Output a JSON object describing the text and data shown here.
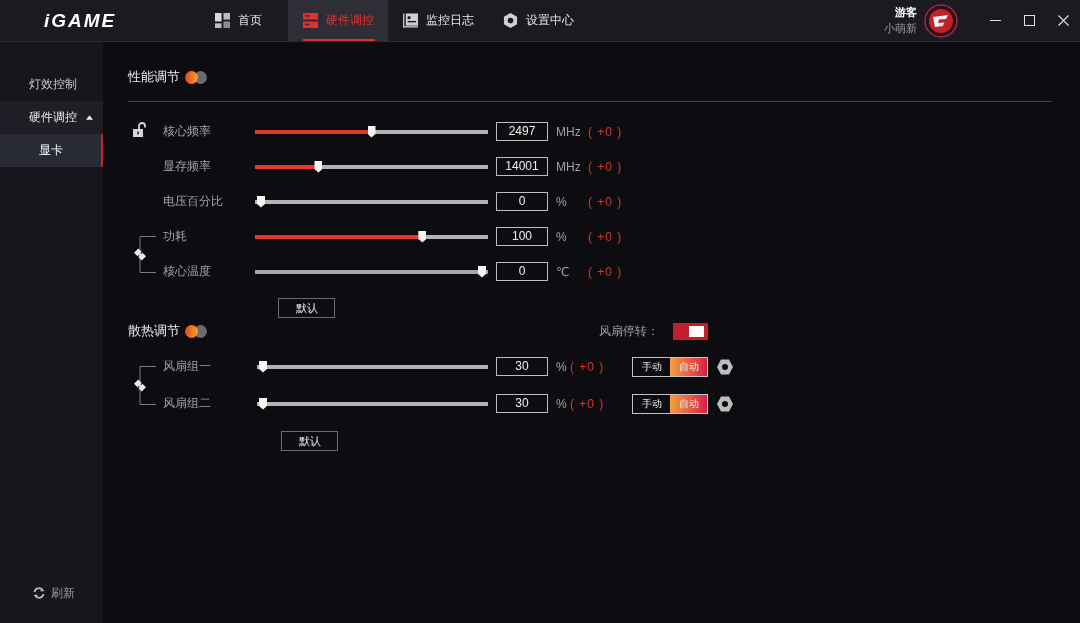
{
  "window": {
    "logo": "iGAME"
  },
  "nav_tabs": [
    {
      "label": "首页",
      "selected": false
    },
    {
      "label": "硬件调控",
      "selected": true
    },
    {
      "label": "监控日志",
      "selected": false
    },
    {
      "label": "设置中心",
      "selected": false
    }
  ],
  "user": {
    "name": "游客",
    "rank": "小萌新"
  },
  "sidebar": {
    "items": [
      {
        "label": "灯效控制",
        "selected": false
      },
      {
        "label": "硬件调控",
        "selected": false,
        "expanded": true,
        "children": [
          {
            "label": "显卡",
            "selected": true
          }
        ]
      }
    ],
    "refresh": "刷新"
  },
  "performance": {
    "title": "性能调节",
    "on": false,
    "rows": [
      {
        "label": "核心频率",
        "level": 0.5,
        "value": "2497",
        "unit": "MHz",
        "delta": "( +0 )",
        "disabled": false
      },
      {
        "label": "显存频率",
        "level": 0.26,
        "value": "14001",
        "unit": "MHz",
        "delta": "( +0 )",
        "disabled": false
      },
      {
        "label": "电压百分比",
        "level": 0,
        "value": "0",
        "unit": "%",
        "delta": "( +0 )",
        "disabled": false
      },
      {
        "label": "功耗",
        "level": 0.73,
        "value": "100",
        "unit": "%",
        "delta": "( +0 )",
        "disabled": false
      },
      {
        "label": "核心温度",
        "level": 1,
        "value": "0",
        "unit": "℃",
        "delta": "( +0 )",
        "disabled": true
      }
    ],
    "default_button": "默认"
  },
  "cooling": {
    "title": "散热调节",
    "on": false,
    "fan_stop": {
      "label": "风扇停转：",
      "on": true
    },
    "rows": [
      {
        "label": "风扇组一",
        "level": 0,
        "value": "30",
        "unit": "%",
        "delta": "( +0 )",
        "modes": [
          {
            "label": "手动",
            "selected": false
          },
          {
            "label": "自动",
            "selected": true
          }
        ]
      },
      {
        "label": "风扇组二",
        "level": 0,
        "value": "30",
        "unit": "%",
        "delta": "( +0 )",
        "modes": [
          {
            "label": "手动",
            "selected": false
          },
          {
            "label": "自动",
            "selected": true
          }
        ]
      }
    ],
    "default_button": "默认"
  }
}
